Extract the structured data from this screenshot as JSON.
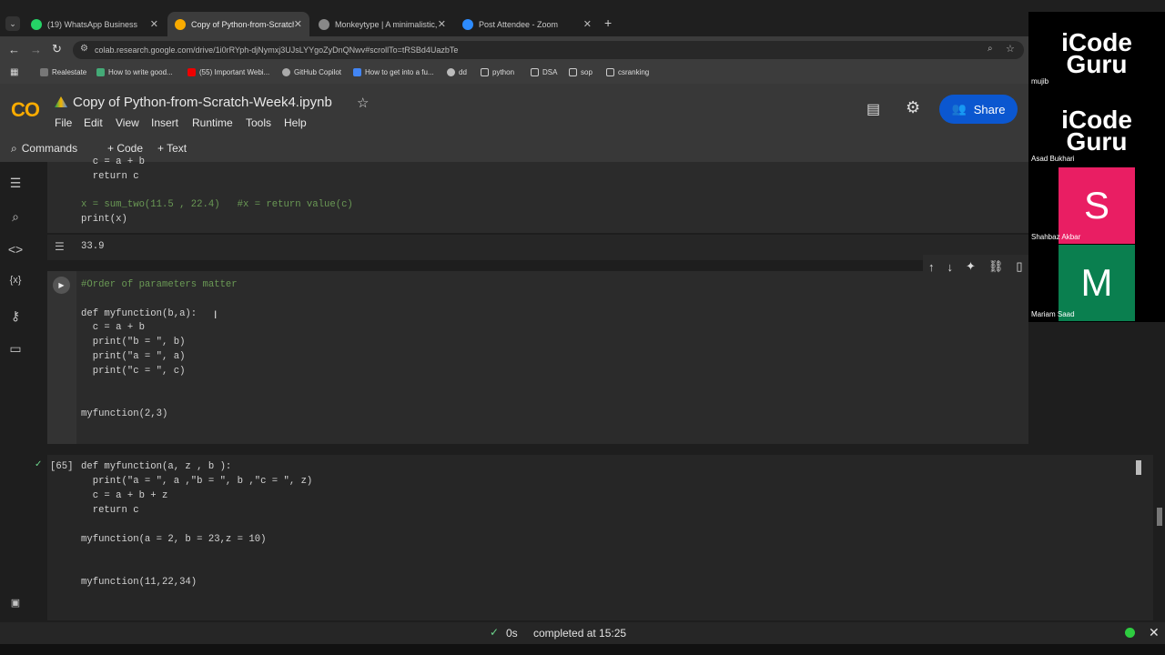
{
  "browser": {
    "tabs": [
      {
        "label": "(19) WhatsApp Business",
        "color": "#25d366"
      },
      {
        "label": "Copy of Python-from-Scratch-W",
        "color": "#f9ab00"
      },
      {
        "label": "Monkeytype | A minimalistic, c",
        "color": "#888888"
      },
      {
        "label": "Post Attendee - Zoom",
        "color": "#2d8cff"
      }
    ],
    "new_tab": "+",
    "url": "colab.research.google.com/drive/1i0rRYph-djNymxj3UJsLYYgoZyDnQNwv#scrollTo=tRSBd4UazbTe",
    "bookmarks": [
      {
        "label": "Realestate"
      },
      {
        "label": "How to write good..."
      },
      {
        "label": "(55) Important Webi..."
      },
      {
        "label": "GitHub Copilot"
      },
      {
        "label": "How to get into a fu..."
      },
      {
        "label": "dd"
      },
      {
        "label": "python"
      },
      {
        "label": "DSA"
      },
      {
        "label": "sop"
      },
      {
        "label": "csranking"
      }
    ]
  },
  "colab": {
    "logo": "CO",
    "notebook_title": "Copy of Python-from-Scratch-Week4.ipynb",
    "menu": [
      "File",
      "Edit",
      "View",
      "Insert",
      "Runtime",
      "Tools",
      "Help"
    ],
    "toolbar": {
      "commands": "Commands",
      "code": "+ Code",
      "text": "+ Text"
    },
    "share_label": "Share"
  },
  "cells": {
    "cell1_lines": [
      "  c = a + b",
      "  return c",
      "",
      "x = sum_two(11.5 , 22.4)   #x = return value(c)",
      "print(x)"
    ],
    "cell1_output": "33.9",
    "cell2_lines": [
      "#Order of parameters matter",
      "",
      "def myfunction(b,a):",
      "  c = a + b",
      "  print(\"b = \", b)",
      "  print(\"a = \", a)",
      "  print(\"c = \", c)",
      "",
      "",
      "myfunction(2,3)"
    ],
    "cell3_exec": "[65]",
    "cell3_lines": [
      "def myfunction(a, z , b ):",
      "  print(\"a = \", a ,\"b = \", b ,\"c = \", z)",
      "  c = a + b + z",
      "  return c",
      "",
      "myfunction(a = 2, b = 23,z = 10)",
      "",
      "",
      "myfunction(11,22,34)"
    ]
  },
  "status": {
    "check": "✓",
    "duration": "0s",
    "completed": "completed at 15:25"
  },
  "zoom": {
    "participants": [
      {
        "name": "mujib",
        "logo_line1": "iCode",
        "logo_line2": "Guru"
      },
      {
        "name": "Asad Bukhari",
        "logo_line1": "iCode",
        "logo_line2": "Guru"
      },
      {
        "name": "Shahbaz Akbar",
        "initial": "S",
        "color": "#e91e63"
      },
      {
        "name": "Mariam Saad",
        "initial": "M",
        "color": "#0a7f4f"
      }
    ]
  }
}
